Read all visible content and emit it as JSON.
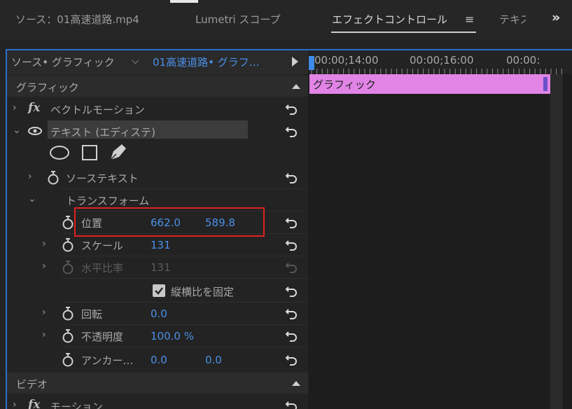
{
  "tabs": {
    "source": "ソース：01高速道路.mp4",
    "lumetri": "Lumetri スコープ",
    "effect_controls": "エフェクトコントロール",
    "menu_icon": "≡",
    "text_partial": "テキス",
    "overflow": "»"
  },
  "source_bar": {
    "source": "ソース• グラフィック",
    "clip": "01高速道路• グラフ…"
  },
  "sections": {
    "graphic": "グラフィック",
    "video": "ビデオ"
  },
  "rows": {
    "vector_motion": "ベクトルモーション",
    "text_layer": "テキスト (エディステ)",
    "source_text": "ソーステキスト",
    "transform": "トランスフォーム",
    "position": {
      "label": "位置",
      "x": "662.0",
      "y": "589.8"
    },
    "scale": {
      "label": "スケール",
      "value": "131"
    },
    "scale_width": {
      "label": "水平比率",
      "value": "131"
    },
    "uniform_scale": "縦横比を固定",
    "rotation": {
      "label": "回転",
      "value": "0.0"
    },
    "opacity": {
      "label": "不透明度",
      "value": "100.0 %"
    },
    "anchor": {
      "label": "アンカー…",
      "x": "0.0",
      "y": "0.0"
    },
    "motion": "モーション"
  },
  "timeline": {
    "tc1": "00:00;14:00",
    "tc2": "00:00;16:00",
    "tc3": "00:00:",
    "clip_label": "グラフィック"
  },
  "colors": {
    "accent": "#2d6dcc",
    "value_blue": "#4a90e8",
    "clip_pink": "#e184e6",
    "highlight_red": "#e02020"
  }
}
